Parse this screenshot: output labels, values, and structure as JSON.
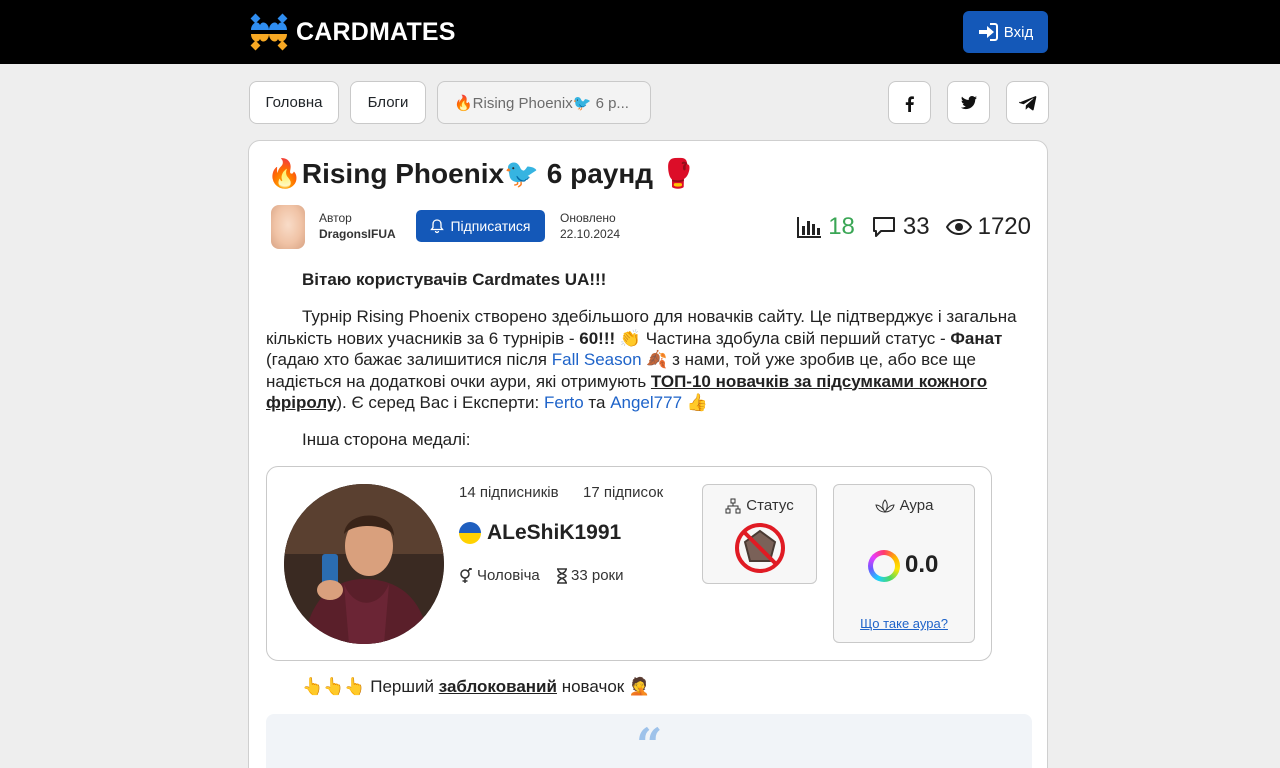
{
  "header": {
    "brand": "CARDMATES",
    "login_label": "Вхід"
  },
  "breadcrumb": {
    "home": "Головна",
    "blogs": "Блоги",
    "current": "🔥Rising Phoenix🐦 6 р..."
  },
  "social": [
    {
      "icon": "facebook-icon"
    },
    {
      "icon": "twitter-icon"
    },
    {
      "icon": "telegram-icon"
    }
  ],
  "post": {
    "title": "🔥Rising Phoenix🐦 6 раунд 🥊",
    "author_label": "Автор",
    "author_name": "DragonsIFUA",
    "follow_label": "Підписатися",
    "updated_label": "Оновлено",
    "updated_date": "22.10.2024",
    "stats": {
      "rating": "18",
      "comments": "33",
      "views": "1720"
    },
    "greeting": "Вітаю користувачів Cardmates UA!!!",
    "para1": {
      "t1": "Турнір Rising Phoenix створено здебільшого для новачків сайту. Це підтверджує і загальна кількість нових учасників за 6 турнірів - ",
      "count": "60!!!",
      "t2": " 👏 Частина здобула свій перший статус - ",
      "status": "Фанат",
      "t3": " (гадаю хто бажає залишитися після ",
      "link_fall": "Fall Season",
      "t4": " 🍂 з нами, той уже зробив це, або все ще надіється на додаткові очки аури, які отримують ",
      "top10": "ТОП-10 новачків за підсумками кожного фріролу",
      "t5": "). Є серед Вас і Експерти: ",
      "expert1": "Ferto",
      "t6": " та ",
      "expert2": "Angel777",
      "t7": " 👍"
    },
    "para2": "Інша сторона медалі:",
    "para3": {
      "t1": "👆👆👆 Перший ",
      "blocked": "заблокований",
      "t2": " новачок 🤦"
    },
    "quote_mark": "“"
  },
  "profile": {
    "followers": "14 підписників",
    "following": "17 підписок",
    "name": "ALeShiK1991",
    "gender": "Чоловіча",
    "age": "33 роки",
    "status_label": "Статус",
    "aura_label": "Аура",
    "aura_value": "0.0",
    "aura_link": "Що таке аура?",
    "flag_colors": [
      "#1f5fbf",
      "#ffd200"
    ]
  },
  "colors": {
    "accent": "#1458b8",
    "link": "#1e63c9",
    "rating": "#3aa655"
  }
}
